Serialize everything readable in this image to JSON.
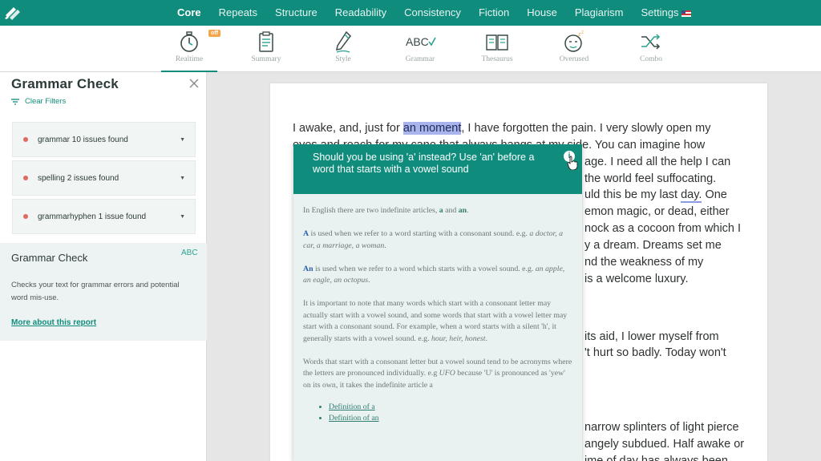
{
  "nav": {
    "tabs": [
      {
        "label": "Core"
      },
      {
        "label": "Repeats"
      },
      {
        "label": "Structure"
      },
      {
        "label": "Readability"
      },
      {
        "label": "Consistency"
      },
      {
        "label": "Fiction"
      },
      {
        "label": "House"
      },
      {
        "label": "Plagiarism"
      },
      {
        "label": "Settings"
      }
    ],
    "active": "Core"
  },
  "toolbar": {
    "items": [
      {
        "label": "Realtime",
        "icon": "stopwatch-icon"
      },
      {
        "label": "Summary",
        "icon": "clipboard-icon"
      },
      {
        "label": "Style",
        "icon": "pencil-icon"
      },
      {
        "label": "Grammar",
        "icon": "abc-check-icon"
      },
      {
        "label": "Thesaurus",
        "icon": "book-icon"
      },
      {
        "label": "Overused",
        "icon": "sleepy-face-icon"
      },
      {
        "label": "Combo",
        "icon": "shuffle-icon"
      }
    ],
    "realtime_badge": "off"
  },
  "sidebar": {
    "title": "Grammar Check",
    "clear_filters": "Clear Filters",
    "issues": [
      {
        "text": "grammar 10 issues found"
      },
      {
        "text": "spelling 2 issues found"
      },
      {
        "text": "grammarhyphen 1 issue found"
      }
    ],
    "info": {
      "title": "Grammar Check",
      "abc": "ABC",
      "description": "Checks your text for grammar errors and potential word mis-use.",
      "link": "More about this report"
    }
  },
  "document": {
    "lines": [
      {
        "before": "I awake, and, just for ",
        "highlight": "an moment",
        "after": ", I have forgotten the pain. I very slowly open my"
      },
      {
        "text": "eyes and reach for my cane that always hangs at my side. You can imagine how"
      },
      {
        "text": "age. I need all the help I can"
      },
      {
        "text": "the world feel suffocating."
      },
      {
        "before": "uld this be my last ",
        "underline": "day.",
        "after": " One"
      },
      {
        "text": "emon magic, or dead, either"
      },
      {
        "text": "nock as a cocoon from which I"
      },
      {
        "text": "y a dream. Dreams set me"
      },
      {
        "text": "nd the weakness of my"
      },
      {
        "text": "is a welcome luxury."
      },
      {
        "text": "its aid, I lower myself from"
      },
      {
        "text": "'t hurt so badly. Today won't"
      },
      {
        "text": "narrow splinters of light pierce"
      },
      {
        "text": "angely subdued. Half awake or"
      },
      {
        "text": "ime of day has always been"
      }
    ]
  },
  "tooltip": {
    "title": "Should you be using 'a' instead? Use 'an' before a word that starts with a vowel sound",
    "p1_prefix": "In English there are two indefinite articles, ",
    "p1_a": "a",
    "p1_and": " and ",
    "p1_an": "an",
    "p1_end": ".",
    "p2_strong": "A",
    "p2_text": " is used when we refer to a word starting with a consonant sound. e.g. ",
    "p2_examples": "a doctor, a car, a marriage, a woman",
    "p2_end": ".",
    "p3_strong": "An",
    "p3_text": " is used when we refer to a word which starts with a vowel sound. e.g. ",
    "p3_examples": "an apple, an eagle, an octopus",
    "p3_end": ".",
    "p4_text": "It is important to note that many words which start with a consonant letter may actually start with a vowel sound, and some words that start with a vowel letter may start with a consonant sound. For example, when a word starts with a silent 'h', it generally starts with a vowel sound. e.g. ",
    "p4_examples": "hour, heir, honest",
    "p4_end": ".",
    "p5_text": "Words that start with a consonant letter but a vowel sound tend to be acronyms where the letters are pronounced individually. e.g ",
    "p5_example": "UFO",
    "p5_rest": " because 'U' is pronounced as 'yew' on its own, it takes the indefinite article a",
    "links": [
      "Definition of a",
      "Definition of an"
    ]
  },
  "colors": {
    "accent": "#0f8c7c",
    "highlight": "#a9b3ec",
    "issue_dot": "#e06a5b"
  }
}
